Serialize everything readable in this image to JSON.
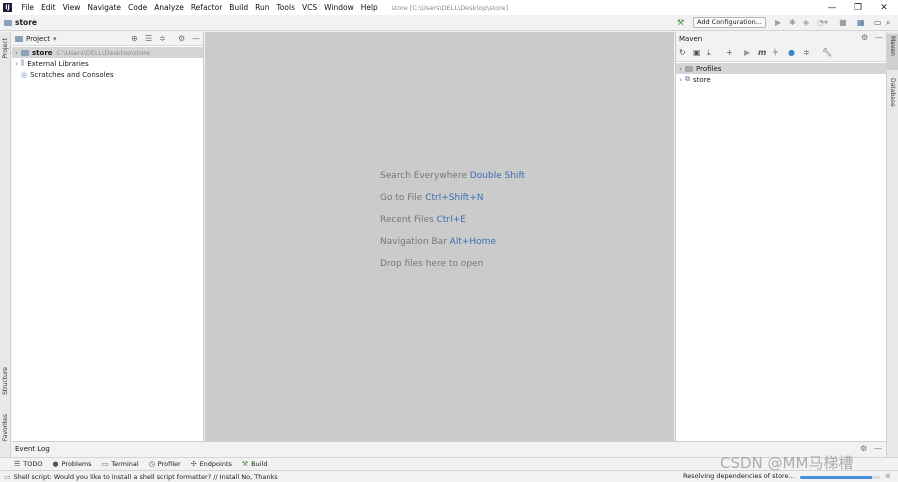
{
  "titlebar": {
    "logo": "IJ",
    "menu": [
      "File",
      "Edit",
      "View",
      "Navigate",
      "Code",
      "Analyze",
      "Refactor",
      "Build",
      "Run",
      "Tools",
      "VCS",
      "Window",
      "Help"
    ],
    "title": "store [C:\\Users\\DELL\\Desktop\\store]",
    "minimize": "—",
    "restore": "❐",
    "close": "✕"
  },
  "navbar": {
    "project_name": "store",
    "add_configuration": "Add Configuration...",
    "icons": [
      "hammer-icon",
      "run-icon",
      "debug-icon",
      "coverage-icon",
      "profile-icon",
      "stop-icon",
      "project-structure-icon",
      "layout-icon",
      "search-icon"
    ]
  },
  "left_stripe": {
    "project_tab": "Project",
    "structure_tab": "Structure",
    "favorites_tab": "Favorites"
  },
  "project_panel": {
    "title": "Project",
    "tree": [
      {
        "label": "store",
        "hint": "C:\\Users\\DELL\\Desktop\\store",
        "selected": true
      },
      {
        "label": "External Libraries",
        "hint": ""
      },
      {
        "label": "Scratches and Consoles",
        "hint": ""
      }
    ]
  },
  "editor": {
    "hints": [
      {
        "text": "Search Everywhere",
        "shortcut": "Double Shift"
      },
      {
        "text": "Go to File",
        "shortcut": "Ctrl+Shift+N"
      },
      {
        "text": "Recent Files",
        "shortcut": "Ctrl+E"
      },
      {
        "text": "Navigation Bar",
        "shortcut": "Alt+Home"
      },
      {
        "text": "Drop files here to open",
        "shortcut": ""
      }
    ]
  },
  "maven_panel": {
    "title": "Maven",
    "tree": [
      {
        "label": "Profiles"
      },
      {
        "label": "store"
      }
    ]
  },
  "right_stripe": {
    "maven_tab": "Maven",
    "database_tab": "Database"
  },
  "event_log": {
    "label": "Event Log"
  },
  "tool_buttons": [
    {
      "label": "TODO",
      "icon": "list-icon"
    },
    {
      "label": "Problems",
      "icon": "problems-icon"
    },
    {
      "label": "Terminal",
      "icon": "terminal-icon"
    },
    {
      "label": "Profiler",
      "icon": "profiler-icon"
    },
    {
      "label": "Endpoints",
      "icon": "endpoints-icon"
    },
    {
      "label": "Build",
      "icon": "build-icon"
    }
  ],
  "statusbar": {
    "message": "Shell script: Would you like to install a shell script formatter? // Install   No, Thanks",
    "progress_text": "Resolving dependencies of store...",
    "progress": 0.9
  },
  "watermark": "CSDN @MM马梯槽",
  "colors": {
    "accent": "#3c6eb4",
    "editor_bg": "#cbcbcb",
    "progress": "#4a8fd9"
  }
}
